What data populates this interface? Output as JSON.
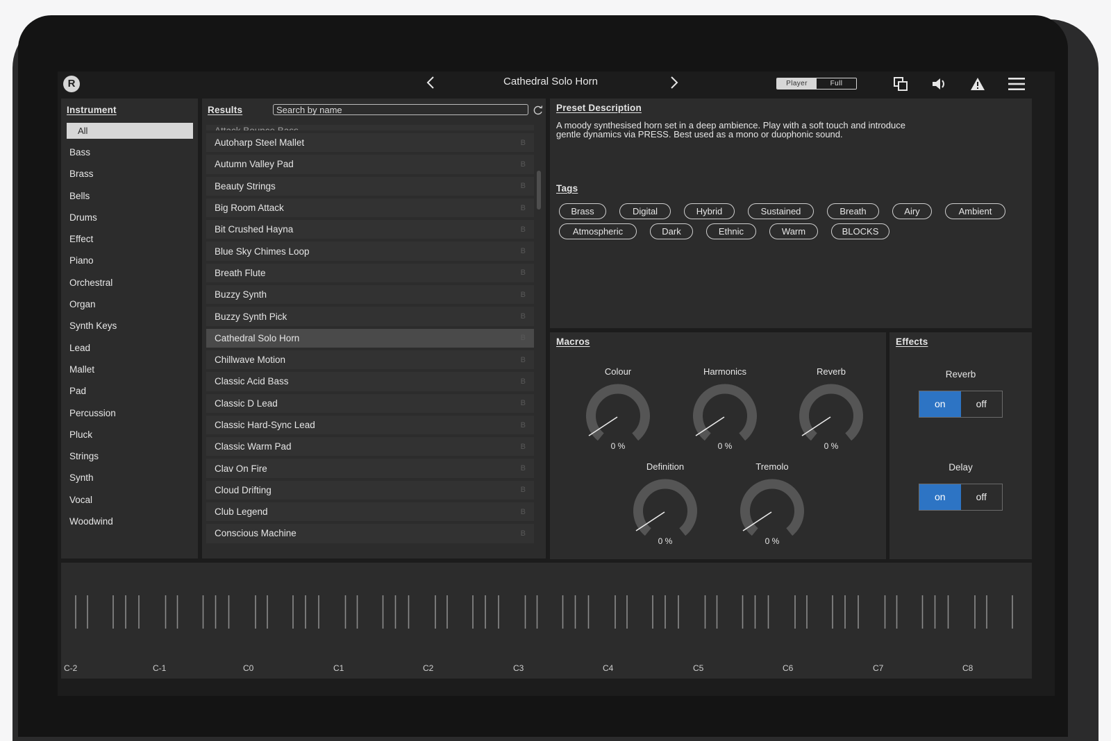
{
  "header": {
    "logo": "R",
    "preset_name": "Cathedral Solo Horn",
    "mode_player": "Player",
    "mode_full": "Full"
  },
  "instrument": {
    "title": "Instrument",
    "selected": "All",
    "items": [
      "Bass",
      "Brass",
      "Bells",
      "Drums",
      "Effect",
      "Piano",
      "Orchestral",
      "Organ",
      "Synth Keys",
      "Lead",
      "Mallet",
      "Pad",
      "Percussion",
      "Pluck",
      "Strings",
      "Synth",
      "Vocal",
      "Woodwind"
    ]
  },
  "results": {
    "title": "Results",
    "search_placeholder": "Search by name",
    "partial_item": "Attack Bounce Bass",
    "badge": "B",
    "selected": "Cathedral Solo Horn",
    "items": [
      "Autoharp Steel Mallet",
      "Autumn Valley Pad",
      "Beauty Strings",
      "Big Room Attack",
      "Bit Crushed Hayna",
      "Blue Sky Chimes Loop",
      "Breath Flute",
      "Buzzy Synth",
      "Buzzy Synth Pick",
      "Cathedral Solo Horn",
      "Chillwave Motion",
      "Classic Acid Bass",
      "Classic D Lead",
      "Classic Hard-Sync Lead",
      "Classic Warm Pad",
      "Clav On Fire",
      "Cloud Drifting",
      "Club Legend",
      "Conscious Machine"
    ]
  },
  "description": {
    "title": "Preset Description",
    "line1": "A moody synthesised horn set in a deep ambience. Play with a soft touch and introduce",
    "line2": "gentle dynamics via PRESS. Best used as a mono or duophonic sound."
  },
  "tags": {
    "title": "Tags",
    "row1": [
      "Brass",
      "Digital",
      "Hybrid",
      "Sustained",
      "Breath",
      "Airy",
      "Ambient"
    ],
    "row2": [
      "Atmospheric",
      "Dark",
      "Ethnic",
      "Warm",
      "BLOCKS"
    ]
  },
  "macros": {
    "title": "Macros",
    "knobs": [
      {
        "label": "Colour",
        "value": "0 %"
      },
      {
        "label": "Harmonics",
        "value": "0 %"
      },
      {
        "label": "Reverb",
        "value": "0 %"
      },
      {
        "label": "Definition",
        "value": "0 %"
      },
      {
        "label": "Tremolo",
        "value": "0 %"
      }
    ]
  },
  "effects": {
    "title": "Effects",
    "reverb": {
      "label": "Reverb",
      "on": "on",
      "off": "off",
      "state": "on"
    },
    "delay": {
      "label": "Delay",
      "on": "on",
      "off": "off",
      "state": "on"
    }
  },
  "keyboard": {
    "octaves": [
      "C-2",
      "C-1",
      "C0",
      "C1",
      "C2",
      "C3",
      "C4",
      "C5",
      "C6",
      "C7",
      "C8"
    ]
  },
  "colors": {
    "accent_on": "#2d74c4",
    "panel": "#2c2c2c",
    "background": "#1c1c1c"
  }
}
